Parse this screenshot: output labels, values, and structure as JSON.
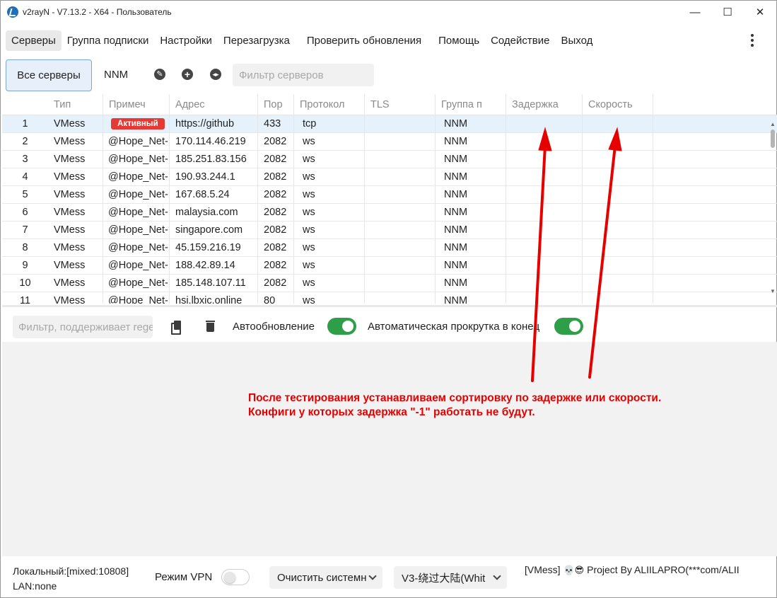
{
  "window": {
    "title": "v2rayN - V7.13.2 - X64 - Пользователь",
    "minimize": "—",
    "maximize": "☐",
    "close": "✕"
  },
  "menu": {
    "items": [
      "Серверы",
      "Группа подписки",
      "Настройки",
      "Перезагрузка",
      "Проверить обновления",
      "Помощь",
      "Содействие",
      "Выход"
    ]
  },
  "toolbar": {
    "all_servers": "Все серверы",
    "group": "NNM",
    "filter_placeholder": "Фильтр серверов"
  },
  "grid": {
    "columns": [
      "Тип",
      "Примеч",
      "Адрес",
      "Пор",
      "Протокол",
      "TLS",
      "Группа п",
      "Задержка",
      "Скорость"
    ],
    "rows": [
      {
        "n": "1",
        "type": "VMess",
        "remark": "Активный",
        "addr": "https://github",
        "port": "433",
        "proto": "tcp",
        "group": "NNM"
      },
      {
        "n": "2",
        "type": "VMess",
        "remark": "@Hope_Net-",
        "addr": "170.114.46.219",
        "port": "2082",
        "proto": "ws",
        "group": "NNM"
      },
      {
        "n": "3",
        "type": "VMess",
        "remark": "@Hope_Net-",
        "addr": "185.251.83.156",
        "port": "2082",
        "proto": "ws",
        "group": "NNM"
      },
      {
        "n": "4",
        "type": "VMess",
        "remark": "@Hope_Net-",
        "addr": "190.93.244.1",
        "port": "2082",
        "proto": "ws",
        "group": "NNM"
      },
      {
        "n": "5",
        "type": "VMess",
        "remark": "@Hope_Net-",
        "addr": "167.68.5.24",
        "port": "2082",
        "proto": "ws",
        "group": "NNM"
      },
      {
        "n": "6",
        "type": "VMess",
        "remark": "@Hope_Net-",
        "addr": "malaysia.com",
        "port": "2082",
        "proto": "ws",
        "group": "NNM"
      },
      {
        "n": "7",
        "type": "VMess",
        "remark": "@Hope_Net-",
        "addr": "singapore.com",
        "port": "2082",
        "proto": "ws",
        "group": "NNM"
      },
      {
        "n": "8",
        "type": "VMess",
        "remark": "@Hope_Net-",
        "addr": "45.159.216.19",
        "port": "2082",
        "proto": "ws",
        "group": "NNM"
      },
      {
        "n": "9",
        "type": "VMess",
        "remark": "@Hope_Net-",
        "addr": "188.42.89.14",
        "port": "2082",
        "proto": "ws",
        "group": "NNM"
      },
      {
        "n": "10",
        "type": "VMess",
        "remark": "@Hope_Net-",
        "addr": "185.148.107.11",
        "port": "2082",
        "proto": "ws",
        "group": "NNM"
      },
      {
        "n": "11",
        "type": "VMess",
        "remark": "@Hope_Net-",
        "addr": "hsi.lbxic.online",
        "port": "80",
        "proto": "ws",
        "group": "NNM"
      }
    ]
  },
  "log": {
    "filter_placeholder": "Фильтр, поддерживает regex",
    "auto_refresh": "Автообновление",
    "auto_scroll": "Автоматическая прокрутка в конец",
    "auto_refresh_on": true,
    "auto_scroll_on": true
  },
  "annotation": {
    "line1": "После тестирования устанавливаем сортировку по задержке или скорости.",
    "line2": "Конфиги у которых задержка \"-1\" работать не будут.",
    "color": "#e60000"
  },
  "status": {
    "local": "Локальный:[mixed:10808]",
    "lan": "LAN:none",
    "vpn_mode": "Режим VPN",
    "vpn_on": false,
    "clear_system": "Очистить системн",
    "routing": "V3-绕过大陆(Whit",
    "info_prefix": "[VMess]",
    "info_suffix": "Project By ALIILAPRO(***com/ALII"
  },
  "colors": {
    "accent_selection": "#e6f2fb",
    "toggle_on": "#2e9e48",
    "badge": "#e53935"
  }
}
